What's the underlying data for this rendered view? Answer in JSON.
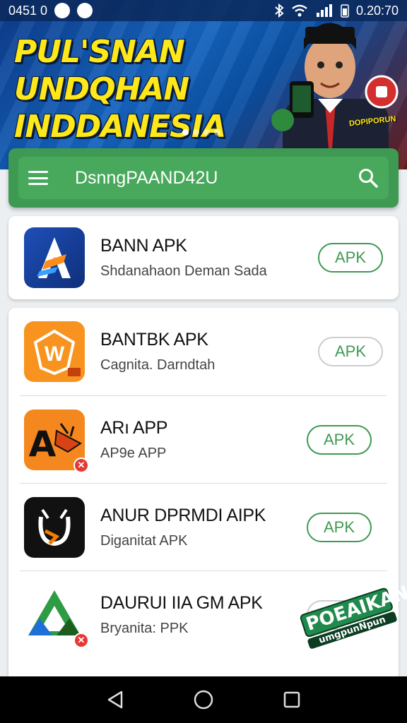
{
  "status_bar": {
    "left_text": "0451 0",
    "time": "0.20:70",
    "icons": [
      "shield-icon",
      "butterfly-icon",
      "bluetooth-icon",
      "wifi-icon",
      "signal-icon",
      "battery-icon"
    ]
  },
  "banner": {
    "title": "PUL'SNAN UNDQHAN INDDANESIA",
    "stamp_text": "DOPIPORUN",
    "dots_count": 4,
    "active_dot": 0
  },
  "search": {
    "text": "DsnngPAAND42U",
    "accent": "#3e9a52"
  },
  "apps": [
    {
      "name": "BANN APK",
      "subtitle": "Shdanahaon Deman Sada",
      "button": "APK",
      "icon": "blue-a-icon"
    },
    {
      "name": "BANTBK APK",
      "subtitle": "Cagnita. Darndtah",
      "button": "APK",
      "icon": "orange-w-icon"
    },
    {
      "name": "ARı APP",
      "subtitle": "AP9e APP",
      "button": "APK",
      "icon": "orange-a-icon"
    },
    {
      "name": "ANUR DPRMDI AIPK",
      "subtitle": "Diganitat APK",
      "button": "APK",
      "icon": "black-u-icon"
    },
    {
      "name": "DAURUI IIA GM APK",
      "subtitle": "Bryanita: PPK",
      "button": "APK",
      "icon": "green-triangle-icon"
    }
  ],
  "watermark": {
    "line1": "POEAIKAN",
    "line2": "umgpunNpun"
  },
  "colors": {
    "green": "#3e9a52",
    "banner_yellow": "#ffe81a",
    "banner_blue": "#1565c0"
  }
}
